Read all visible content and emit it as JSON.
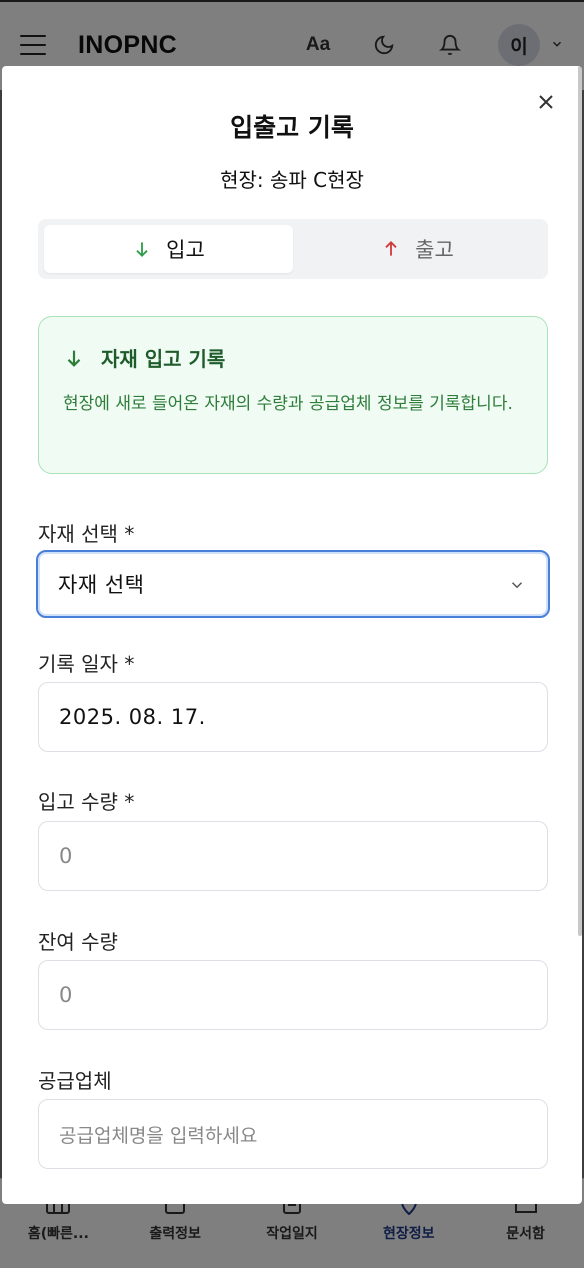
{
  "header": {
    "brand": "INOPNC",
    "font_toggle": "Aa",
    "avatar_initial": "이"
  },
  "bottom_nav": [
    {
      "label": "홈(빠른...",
      "icon": "home-icon"
    },
    {
      "label": "출력정보",
      "icon": "document-icon"
    },
    {
      "label": "작업일지",
      "icon": "journal-icon"
    },
    {
      "label": "현장정보",
      "icon": "location-icon",
      "active": true
    },
    {
      "label": "문서함",
      "icon": "folder-icon"
    }
  ],
  "modal": {
    "title": "입출고 기록",
    "subtitle": "현장: 송파 C현장",
    "tabs": [
      {
        "label": "입고",
        "icon": "arrow-down-icon",
        "color": "#2e9e4a",
        "active": true
      },
      {
        "label": "출고",
        "icon": "arrow-up-icon",
        "color": "#d23b3b",
        "active": false
      }
    ],
    "info": {
      "title": "자재 입고 기록",
      "description": "현장에 새로 들어온 자재의 수량과 공급업체 정보를 기록합니다."
    },
    "fields": {
      "material": {
        "label": "자재 선택 *",
        "value": "자재 선택"
      },
      "date": {
        "label": "기록 일자 *",
        "value": "2025. 08. 17."
      },
      "in_qty": {
        "label": "입고 수량 *",
        "placeholder": "0"
      },
      "remain_qty": {
        "label": "잔여 수량",
        "placeholder": "0"
      },
      "supplier": {
        "label": "공급업체",
        "placeholder": "공급업체명을 입력하세요"
      }
    }
  },
  "colors": {
    "accent_blue": "#4a7fd8",
    "info_bg": "#f0fbf3",
    "info_border": "#a7e3b8",
    "info_text": "#2e7d3a",
    "nav_active": "#1e3a8a"
  }
}
